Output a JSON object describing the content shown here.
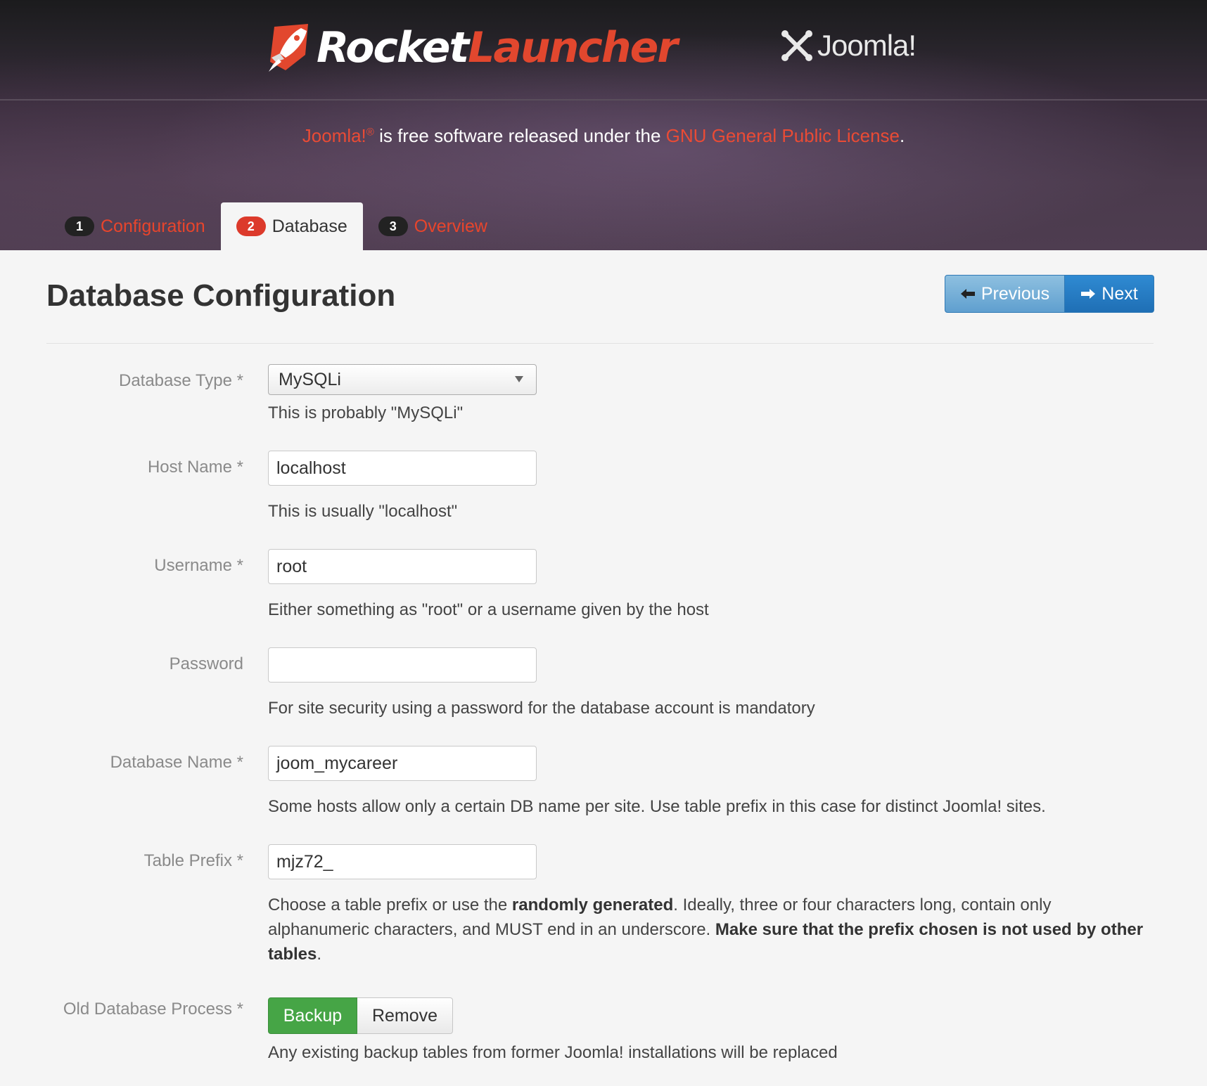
{
  "header": {
    "logo_rocket": "Rocket",
    "logo_launcher": "Launcher",
    "joomla_logo": "Joomla!",
    "license_joomla": "Joomla!",
    "license_reg": "®",
    "license_middle": " is free software released under the ",
    "license_link": "GNU General Public License",
    "license_end": "."
  },
  "tabs": [
    {
      "num": "1",
      "label": "Configuration"
    },
    {
      "num": "2",
      "label": "Database",
      "active": true
    },
    {
      "num": "3",
      "label": "Overview"
    }
  ],
  "page": {
    "title": "Database Configuration",
    "previous_label": "Previous",
    "next_label": "Next"
  },
  "form": {
    "db_type": {
      "label": "Database Type *",
      "value": "MySQLi",
      "help": "This is probably \"MySQLi\""
    },
    "host": {
      "label": "Host Name *",
      "value": "localhost",
      "help": "This is usually \"localhost\""
    },
    "username": {
      "label": "Username *",
      "value": "root",
      "help": "Either something as \"root\" or a username given by the host"
    },
    "password": {
      "label": "Password",
      "value": "",
      "help": "For site security using a password for the database account is mandatory"
    },
    "db_name": {
      "label": "Database Name *",
      "value": "joom_mycareer",
      "help": "Some hosts allow only a certain DB name per site. Use table prefix in this case for distinct Joomla! sites."
    },
    "prefix": {
      "label": "Table Prefix *",
      "value": "mjz72_",
      "help_1": "Choose a table prefix or use the ",
      "help_bold_1": "randomly generated",
      "help_2": ". Ideally, three or four characters long, contain only alphanumeric characters, and MUST end in an underscore. ",
      "help_bold_2": "Make sure that the prefix chosen is not used by other tables",
      "help_3": "."
    },
    "old_db": {
      "label": "Old Database Process *",
      "backup_label": "Backup",
      "remove_label": "Remove",
      "selected": "Backup",
      "help": "Any existing backup tables from former Joomla! installations will be replaced"
    }
  },
  "colors": {
    "accent_red": "#e8452c",
    "primary_blue": "#2f8ad2",
    "success_green": "#46a546"
  }
}
